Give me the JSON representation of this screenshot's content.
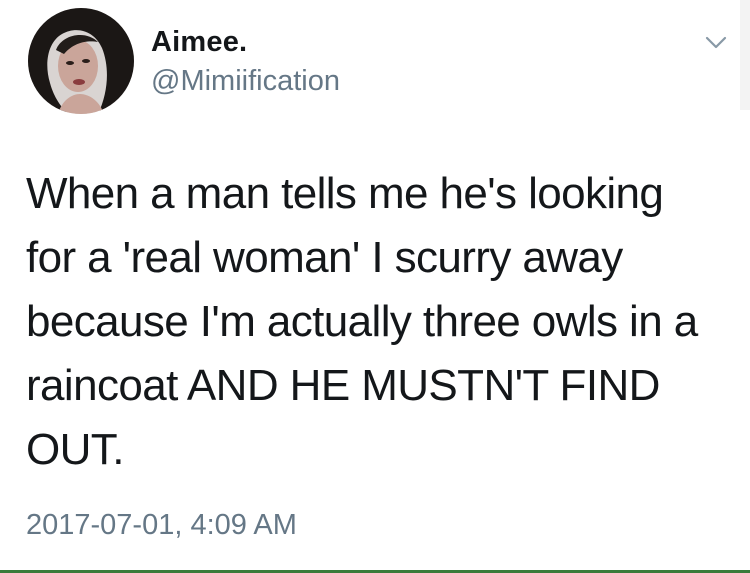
{
  "tweet": {
    "author": {
      "display_name": "Aimee.",
      "handle": "@Mimiification",
      "avatar_icon": "profile-photo"
    },
    "menu_icon": "chevron-down-icon",
    "text": "When a man tells me he's looking for a 'real woman' I scurry away because I'm actually three owls in a raincoat AND HE MUSTN'T FIND OUT.",
    "timestamp": "2017-07-01, 4:09 AM"
  },
  "colors": {
    "name": "#14171a",
    "secondary": "#657786",
    "background": "#ffffff"
  }
}
